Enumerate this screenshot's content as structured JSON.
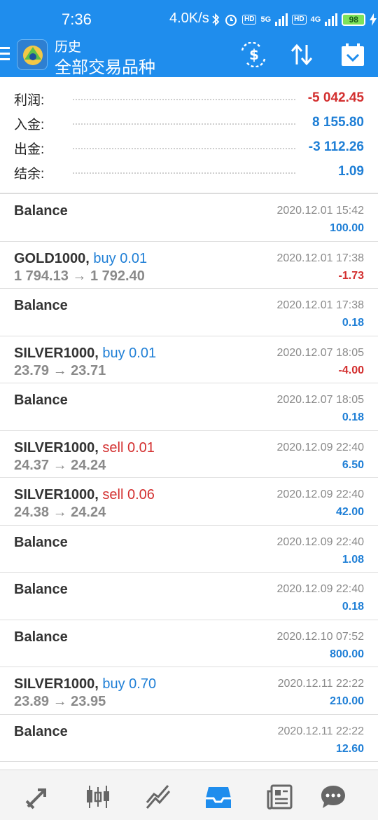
{
  "status": {
    "time": "7:36",
    "speed": "4.0K/s",
    "net1": "5G",
    "net2": "4G",
    "battery": "98"
  },
  "header": {
    "subtitle": "历史",
    "title": "全部交易品种"
  },
  "colors": {
    "accent": "#1f8ded",
    "positive": "#1f7fd6",
    "negative": "#d32f2f"
  },
  "summary": [
    {
      "label": "利润:",
      "value": "-5 042.45",
      "tone": "neg"
    },
    {
      "label": "入金:",
      "value": "8 155.80",
      "tone": "pos"
    },
    {
      "label": "出金:",
      "value": "-3 112.26",
      "tone": "pos"
    },
    {
      "label": "结余:",
      "value": "1.09",
      "tone": "pos"
    }
  ],
  "deals": [
    {
      "symbol": "Balance",
      "side": "",
      "prices": "",
      "datetime": "2020.12.01 15:42",
      "profit": "100.00",
      "tone": "pos"
    },
    {
      "symbol": "GOLD1000,",
      "side": "buy 0.01",
      "sideType": "buy",
      "prices": "1 794.13 → 1 792.40",
      "datetime": "2020.12.01 17:38",
      "profit": "-1.73",
      "tone": "neg"
    },
    {
      "symbol": "Balance",
      "side": "",
      "prices": "",
      "datetime": "2020.12.01 17:38",
      "profit": "0.18",
      "tone": "pos"
    },
    {
      "symbol": "SILVER1000,",
      "side": "buy 0.01",
      "sideType": "buy",
      "prices": "23.79 → 23.71",
      "datetime": "2020.12.07 18:05",
      "profit": "-4.00",
      "tone": "neg"
    },
    {
      "symbol": "Balance",
      "side": "",
      "prices": "",
      "datetime": "2020.12.07 18:05",
      "profit": "0.18",
      "tone": "pos"
    },
    {
      "symbol": "SILVER1000,",
      "side": "sell 0.01",
      "sideType": "sell",
      "prices": "24.37 → 24.24",
      "datetime": "2020.12.09 22:40",
      "profit": "6.50",
      "tone": "pos"
    },
    {
      "symbol": "SILVER1000,",
      "side": "sell 0.06",
      "sideType": "sell",
      "prices": "24.38 → 24.24",
      "datetime": "2020.12.09 22:40",
      "profit": "42.00",
      "tone": "pos"
    },
    {
      "symbol": "Balance",
      "side": "",
      "prices": "",
      "datetime": "2020.12.09 22:40",
      "profit": "1.08",
      "tone": "pos"
    },
    {
      "symbol": "Balance",
      "side": "",
      "prices": "",
      "datetime": "2020.12.09 22:40",
      "profit": "0.18",
      "tone": "pos"
    },
    {
      "symbol": "Balance",
      "side": "",
      "prices": "",
      "datetime": "2020.12.10 07:52",
      "profit": "800.00",
      "tone": "pos"
    },
    {
      "symbol": "SILVER1000,",
      "side": "buy 0.70",
      "sideType": "buy",
      "prices": "23.89 → 23.95",
      "datetime": "2020.12.11 22:22",
      "profit": "210.00",
      "tone": "pos"
    },
    {
      "symbol": "Balance",
      "side": "",
      "prices": "",
      "datetime": "2020.12.11 22:22",
      "profit": "12.60",
      "tone": "pos"
    }
  ],
  "nav": [
    {
      "icon": "trade-arrows-icon"
    },
    {
      "icon": "candlestick-chart-icon"
    },
    {
      "icon": "trend-chart-icon"
    },
    {
      "icon": "history-inbox-icon"
    },
    {
      "icon": "news-icon"
    },
    {
      "icon": "chat-icon"
    }
  ]
}
